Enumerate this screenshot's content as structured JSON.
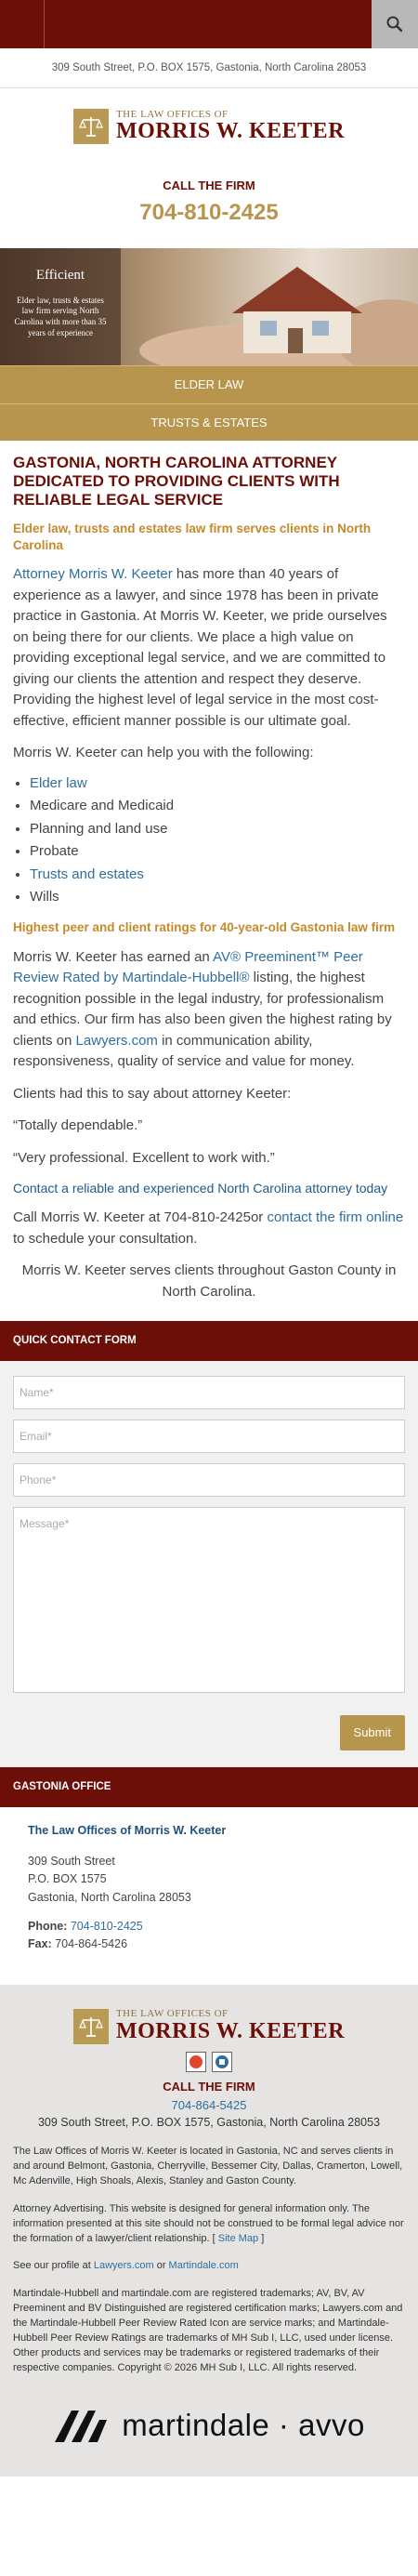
{
  "header": {
    "address": "309 South Street, P.O. BOX 1575, Gastonia, North Carolina 28053"
  },
  "logo": {
    "sub": "THE LAW OFFICES OF",
    "main": "MORRIS W. KEETER"
  },
  "call": {
    "heading": "CALL THE FIRM",
    "phone": "704-810-2425"
  },
  "hero": {
    "title": "Efficient",
    "description": "Elder law, trusts & estates law firm serving North Carolina with more than 35 years of experience"
  },
  "nav": {
    "items": [
      "ELDER LAW",
      "TRUSTS & ESTATES"
    ]
  },
  "main": {
    "title": "GASTONIA, NORTH CAROLINA ATTORNEY DEDICATED TO PROVIDING CLIENTS WITH RELIABLE LEGAL SERVICE",
    "subtitle": "Elder law, trusts and estates law firm serves clients in North Carolina",
    "p1_link": "Attorney Morris W. Keeter",
    "p1_rest": " has more than 40 years of experience as a lawyer, and since 1978 has been in private practice in Gastonia. At Morris W. Keeter, we pride ourselves on being there for our clients. We place a high value on providing exceptional legal service, and we are committed to giving our clients the attention and respect they deserve.  Providing the highest level of legal service in the most cost-effective, efficient manner possible is our ultimate goal.",
    "p2": "Morris W. Keeter can help you with the following:",
    "list": [
      "Elder law",
      "Medicare and Medicaid",
      "Planning and land use",
      "Probate",
      "Trusts and estates",
      "Wills"
    ],
    "h2b": "Highest peer and client ratings for 40-year-old Gastonia law firm",
    "p3_a": "Morris W. Keeter has earned an ",
    "p3_link1": "AV® Preeminent™ Peer Review Rated by Martindale-Hubbell®",
    "p3_b": " listing, the highest recognition possible in the legal industry, for professionalism and ethics. Our firm has also been given the highest rating by clients on ",
    "p3_link2": "Lawyers.com",
    "p3_c": " in communication ability, responsiveness, quality of service and value for money.",
    "p4": "Clients had this to say about attorney Keeter:",
    "q1": "“Totally dependable.”",
    "q2": "“Very professional. Excellent to work with.”",
    "cta_heading": "Contact a reliable and experienced North Carolina attorney today",
    "p5_a": "Call Morris W. Keeter at 704-810-2425or ",
    "p5_link": "contact the firm online",
    "p5_b": " to schedule your consultation.",
    "p6": "Morris W. Keeter serves clients throughout Gaston County in North Carolina."
  },
  "form": {
    "heading": "QUICK CONTACT FORM",
    "name_ph": "Name*",
    "email_ph": "Email*",
    "phone_ph": "Phone*",
    "message_ph": "Message*",
    "submit": "Submit"
  },
  "office": {
    "heading": "GASTONIA OFFICE",
    "name": "The Law Offices of Morris W. Keeter",
    "street": "309 South Street",
    "po": "P.O. BOX 1575",
    "city": "Gastonia, North Carolina 28053",
    "phone_label": "Phone:",
    "phone": "704-810-2425",
    "fax_label": "Fax:",
    "fax": "704-864-5426"
  },
  "footer": {
    "call": "CALL THE FIRM",
    "phone": "704-864-5425",
    "address": "309 South Street, P.O. BOX 1575, Gastonia, North Carolina 28053",
    "p1": "The Law Offices of Morris W. Keeter is located in Gastonia, NC and serves clients in and around Belmont, Gastonia, Cherryville, Bessemer City, Dallas, Cramerton, Lowell, Mc Adenville, High Shoals, Alexis, Stanley and Gaston County.",
    "p2": "Attorney Advertising. This website is designed for general information only. The information presented at this site should not be construed to be formal legal advice nor the formation of a lawyer/client relationship. [ ",
    "sitemap": "Site Map",
    "p2_end": " ]",
    "profile_a": "See our profile at ",
    "profile_link1": "Lawyers.com",
    "profile_or": " or ",
    "profile_link2": "Martindale.com",
    "trademarks": "Martindale-Hubbell and martindale.com are registered trademarks; AV, BV, AV Preeminent and BV Distinguished are registered certification marks; Lawyers.com and the Martindale-Hubbell Peer Review Rated Icon are service marks; and Martindale-Hubbell Peer Review Ratings are trademarks of MH Sub I, LLC, used under license. Other products and services may be trademarks or registered trademarks of their respective companies. Copyright © 2026 MH Sub I, LLC. All rights reserved.",
    "brand": "martindale · avvo"
  },
  "colors": {
    "maroon": "#6b0f08",
    "gold": "#b8954d",
    "link": "#2f6e9e"
  }
}
